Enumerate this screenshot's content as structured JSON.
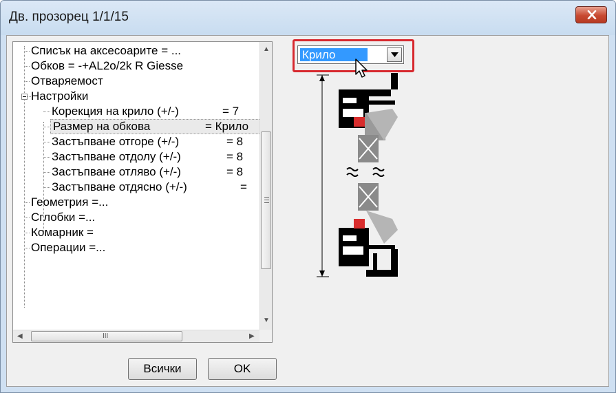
{
  "window": {
    "title": "Дв. прозорец 1/1/15"
  },
  "tree": {
    "items": [
      {
        "label": "Списък на аксесоарите = ...",
        "value": ""
      },
      {
        "label": "Обков =  -+AL2o/2k R Giesse",
        "value": ""
      },
      {
        "label": "Отваряемост",
        "value": ""
      },
      {
        "label": "Настройки",
        "value": "",
        "expanded": true
      },
      {
        "label": "Корекция на крило (+/-)",
        "value": "= 7"
      },
      {
        "label": "Размер на обкова",
        "value": "= Крило",
        "selected": true
      },
      {
        "label": "Застъпване отгоре (+/-)",
        "value": "= 8"
      },
      {
        "label": "Застъпване отдолу (+/-)",
        "value": "= 8"
      },
      {
        "label": "Застъпване отляво (+/-)",
        "value": "= 8"
      },
      {
        "label": "Застъпване отдясно (+/-)",
        "value": "="
      },
      {
        "label": "Геометрия =...",
        "value": ""
      },
      {
        "label": "Сглобки =...",
        "value": ""
      },
      {
        "label": "Комарник =",
        "value": ""
      },
      {
        "label": "Операции =...",
        "value": ""
      }
    ]
  },
  "scroll": {
    "hscroll_grip": "III"
  },
  "buttons": {
    "all_label": "Всички",
    "ok_label": "OK"
  },
  "combo": {
    "selected_value": "Крило"
  },
  "icons": {
    "close": "close-icon",
    "dropdown": "chevron-down-icon",
    "cursor": "pointer-cursor-icon"
  },
  "colors": {
    "highlight_box": "#d7282e",
    "selection": "#3399ff",
    "close_button": "#c84a31"
  }
}
